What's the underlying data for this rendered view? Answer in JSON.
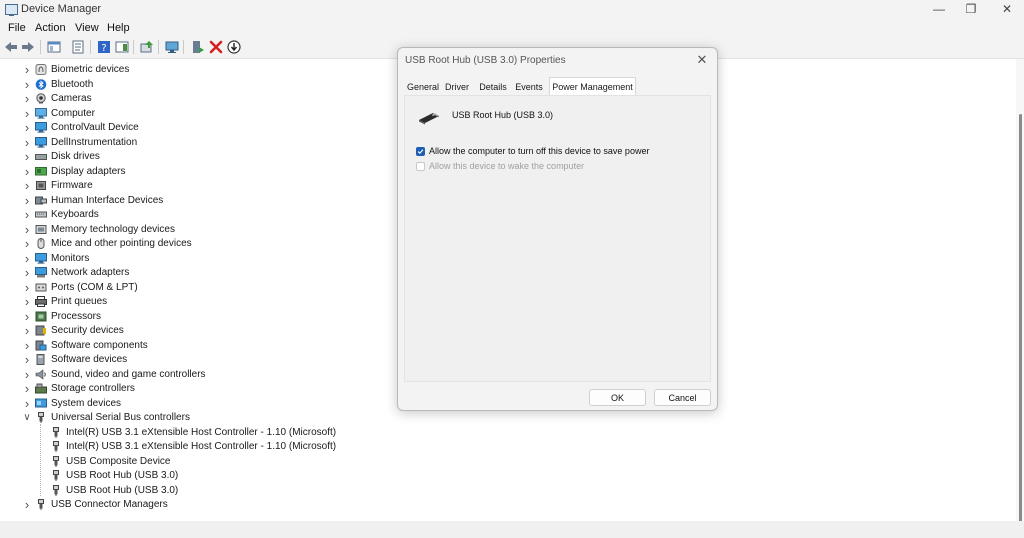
{
  "window": {
    "title": "Device Manager",
    "controls": [
      "minimize-icon",
      "restore-icon",
      "close-icon"
    ]
  },
  "menu": [
    "File",
    "Action",
    "View",
    "Help"
  ],
  "toolbar": {
    "buttons": [
      "back-icon",
      "forward-icon",
      "show-hide-console-tree-icon",
      "properties-icon",
      "help-icon",
      "action-pane-icon",
      "update-driver-icon",
      "scan-hardware-icon",
      "enable-device-icon",
      "uninstall-device-icon",
      "download-icon"
    ]
  },
  "tree": {
    "categories": [
      {
        "label": "Biometric devices",
        "icon": "fingerprint-icon"
      },
      {
        "label": "Bluetooth",
        "icon": "bluetooth-icon"
      },
      {
        "label": "Cameras",
        "icon": "camera-icon"
      },
      {
        "label": "Computer",
        "icon": "computer-icon"
      },
      {
        "label": "ControlVault Device",
        "icon": "monitor-icon"
      },
      {
        "label": "DellInstrumentation",
        "icon": "monitor-icon"
      },
      {
        "label": "Disk drives",
        "icon": "disk-drive-icon"
      },
      {
        "label": "Display adapters",
        "icon": "display-adapter-icon"
      },
      {
        "label": "Firmware",
        "icon": "firmware-icon"
      },
      {
        "label": "Human Interface Devices",
        "icon": "hid-icon"
      },
      {
        "label": "Keyboards",
        "icon": "keyboard-icon"
      },
      {
        "label": "Memory technology devices",
        "icon": "memory-icon"
      },
      {
        "label": "Mice and other pointing devices",
        "icon": "mouse-icon"
      },
      {
        "label": "Monitors",
        "icon": "monitor-icon"
      },
      {
        "label": "Network adapters",
        "icon": "network-adapter-icon"
      },
      {
        "label": "Ports (COM & LPT)",
        "icon": "port-icon"
      },
      {
        "label": "Print queues",
        "icon": "printer-icon"
      },
      {
        "label": "Processors",
        "icon": "processor-icon"
      },
      {
        "label": "Security devices",
        "icon": "security-device-icon"
      },
      {
        "label": "Software components",
        "icon": "software-component-icon"
      },
      {
        "label": "Software devices",
        "icon": "software-device-icon"
      },
      {
        "label": "Sound, video and game controllers",
        "icon": "speaker-icon"
      },
      {
        "label": "Storage controllers",
        "icon": "storage-controller-icon"
      },
      {
        "label": "System devices",
        "icon": "system-device-icon"
      },
      {
        "label": "Universal Serial Bus controllers",
        "icon": "usb-icon",
        "expanded": true
      },
      {
        "label": "USB Connector Managers",
        "icon": "usb-icon"
      }
    ],
    "usb_children": [
      "Intel(R) USB 3.1 eXtensible Host Controller - 1.10 (Microsoft)",
      "Intel(R) USB 3.1 eXtensible Host Controller - 1.10 (Microsoft)",
      "USB Composite Device",
      "USB Root Hub (USB 3.0)",
      "USB Root Hub (USB 3.0)"
    ]
  },
  "dialog": {
    "title": "USB Root Hub (USB 3.0) Properties",
    "tabs": [
      "General",
      "Driver",
      "Details",
      "Events",
      "Power Management"
    ],
    "active_tab": "Power Management",
    "device_name": "USB Root Hub (USB 3.0)",
    "options": [
      {
        "label": "Allow the computer to turn off this device to save power",
        "checked": true,
        "enabled": true
      },
      {
        "label": "Allow this device to wake the computer",
        "checked": false,
        "enabled": false
      }
    ],
    "ok_label": "OK",
    "cancel_label": "Cancel"
  },
  "colors": {
    "accent": "#1e5fb4",
    "chrome": "#f3f3f3",
    "disabled_text": "#a0a0a0"
  }
}
